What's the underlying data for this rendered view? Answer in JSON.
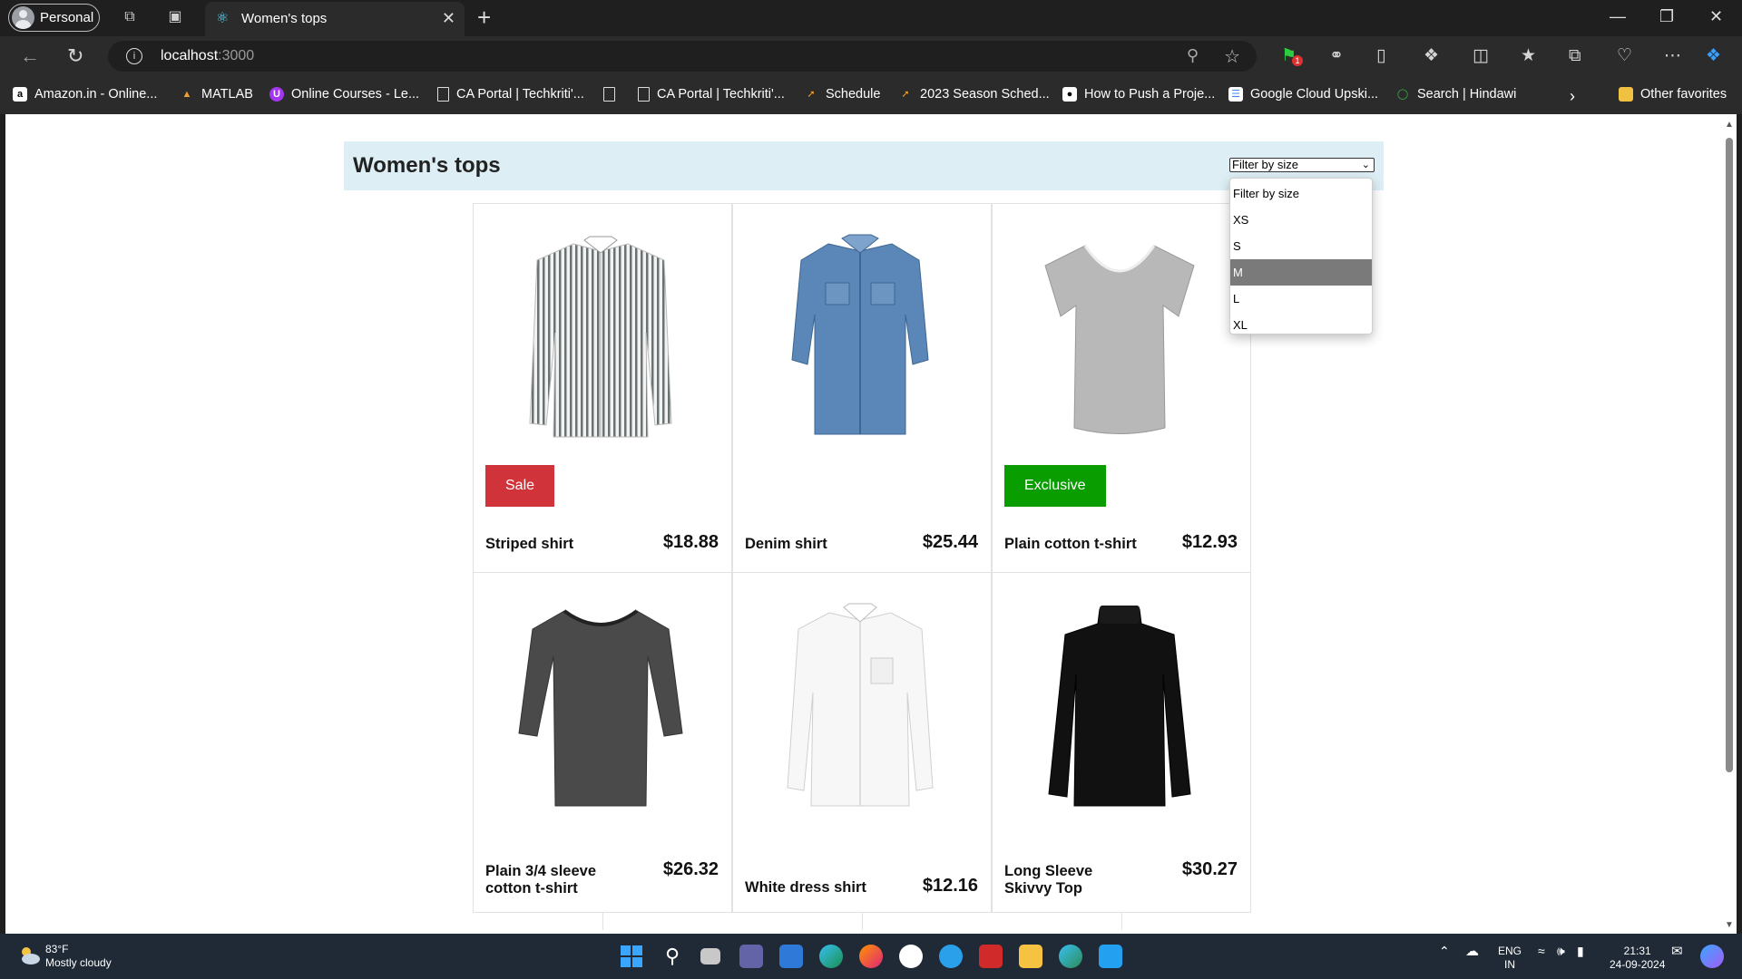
{
  "browser": {
    "profile_label": "Personal",
    "tab_title": "Women's tops",
    "url_host": "localhost",
    "url_port": ":3000"
  },
  "bookmarks": [
    {
      "label": "Amazon.in - Online...",
      "icon": "amazon-icon"
    },
    {
      "label": "MATLAB",
      "icon": "matlab-icon"
    },
    {
      "label": "Online Courses - Le...",
      "icon": "udemy-icon"
    },
    {
      "label": "CA Portal | Techkriti'...",
      "icon": "page-icon"
    },
    {
      "label": "",
      "icon": "page-icon"
    },
    {
      "label": "CA Portal | Techkriti'...",
      "icon": "page-icon"
    },
    {
      "label": "Schedule",
      "icon": "schedule-icon"
    },
    {
      "label": "2023 Season Sched...",
      "icon": "schedule-icon"
    },
    {
      "label": "How to Push a Proje...",
      "icon": "medium-icon"
    },
    {
      "label": "Google Cloud Upski...",
      "icon": "google-cloud-icon"
    },
    {
      "label": "Search | Hindawi",
      "icon": "hindawi-icon"
    },
    {
      "label": "Other favorites",
      "icon": "folder-icon"
    }
  ],
  "page": {
    "title": "Women's tops",
    "filter": {
      "selected": "Filter by size",
      "options": [
        "Filter by size",
        "XS",
        "S",
        "M",
        "L",
        "XL"
      ],
      "highlighted": "M"
    },
    "products": [
      {
        "name": "Striped shirt",
        "price": "$18.88",
        "badge": "Sale",
        "badge_color": "#d0343a",
        "image": "striped-shirt"
      },
      {
        "name": "Denim shirt",
        "price": "$25.44",
        "badge": "",
        "badge_color": "",
        "image": "denim-shirt"
      },
      {
        "name": "Plain cotton t-shirt",
        "price": "$12.93",
        "badge": "Exclusive",
        "badge_color": "#0a9d00",
        "image": "grey-tshirt"
      },
      {
        "name": "Plain 3/4 sleeve cotton t-shirt",
        "price": "$26.32",
        "badge": "",
        "badge_color": "",
        "image": "dark-grey-3-4-sleeve"
      },
      {
        "name": "White dress shirt",
        "price": "$12.16",
        "badge": "",
        "badge_color": "",
        "image": "white-dress-shirt"
      },
      {
        "name": "Long Sleeve Skivvy Top",
        "price": "$30.27",
        "badge": "",
        "badge_color": "",
        "image": "black-skivvy"
      }
    ]
  },
  "taskbar": {
    "temperature": "83°F",
    "weather": "Mostly cloudy",
    "lang": "ENG",
    "region": "IN",
    "time": "21:31",
    "date": "24-09-2024"
  }
}
